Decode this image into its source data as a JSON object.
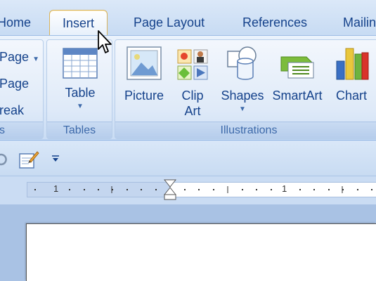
{
  "tabs": [
    "Home",
    "Insert",
    "Page Layout",
    "References",
    "Mailin"
  ],
  "active_tab": "Insert",
  "pages_group": {
    "items": [
      "Page",
      "Page",
      "reak"
    ],
    "label": "s"
  },
  "tables_group": {
    "button_label": "Table",
    "label": "Tables"
  },
  "illustrations_group": {
    "label": "Illustrations",
    "buttons": {
      "picture": "Picture",
      "clip_art_line1": "Clip",
      "clip_art_line2": "Art",
      "shapes": "Shapes",
      "smartart": "SmartArt",
      "chart": "Chart"
    }
  },
  "ruler": {
    "left_number": "1",
    "right_number": "1"
  },
  "colors": {
    "accent": "#15428b",
    "active_tab_border": "#d7b25c"
  }
}
